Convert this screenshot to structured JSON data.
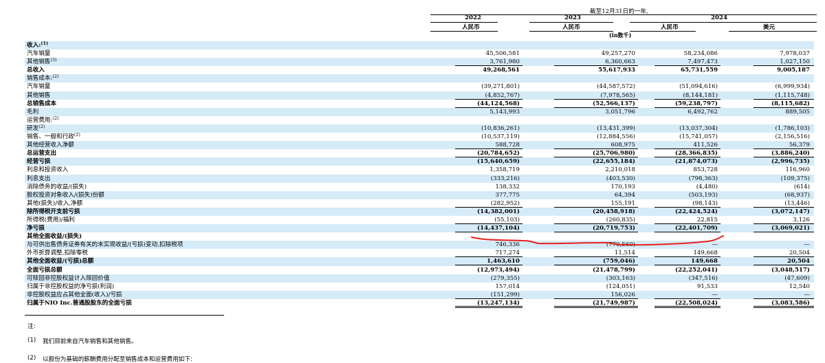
{
  "header": {
    "period": "截至12月31日的一年,",
    "years": [
      "2022",
      "2023",
      "2024"
    ],
    "currencies": [
      "人民币",
      "人民币",
      "人民币",
      "美元"
    ],
    "units": "(in数千)"
  },
  "rows": [
    {
      "label": "收入:",
      "sup": "(1)",
      "v": [
        "",
        "",
        "",
        ""
      ],
      "bold": true
    },
    {
      "label": "汽车销量",
      "sup": "",
      "v": [
        "45,506,581",
        "49,257,270",
        "58,234,086",
        "7,978,037"
      ]
    },
    {
      "label": "其他销售",
      "sup": "(3)",
      "v": [
        "3,761,980",
        "6,360,663",
        "7,497,473",
        "1,027,150"
      ],
      "ul": "single"
    },
    {
      "label": "总收入",
      "sup": "",
      "v": [
        "49,268,561",
        "55,617,933",
        "65,731,559",
        "9,005,187"
      ],
      "bold": true
    },
    {
      "label": "销售成本:",
      "sup": "(2)",
      "v": [
        "",
        "",
        "",
        ""
      ]
    },
    {
      "label": "汽车销量",
      "sup": "",
      "v": [
        "(39,271,801)",
        "(44,587,572)",
        "(51,094,616)",
        "(6,999,934)"
      ]
    },
    {
      "label": "其他销售",
      "sup": "",
      "v": [
        "(4,852,767)",
        "(7,978,565)",
        "(8,144,181)",
        "(1,115,748)"
      ],
      "ul": "single"
    },
    {
      "label": "总销售成本",
      "sup": "",
      "v": [
        "(44,124,568)",
        "(52,566,137)",
        "(59,238,797)",
        "(8,115,682)"
      ],
      "bold": true,
      "ul": "single"
    },
    {
      "label": "毛利",
      "sup": "",
      "v": [
        "5,143,993",
        "3,051,796",
        "6,492,762",
        "889,505"
      ]
    },
    {
      "label": "运营费用:",
      "sup": "(2)",
      "v": [
        "",
        "",
        "",
        ""
      ]
    },
    {
      "label": "研发",
      "sup": "(2)",
      "v": [
        "(10,836,261)",
        "(13,431,399)",
        "(13,037,304)",
        "(1,786,103)"
      ]
    },
    {
      "label": "销售、一般和行政",
      "sup": "(2)",
      "v": [
        "(10,537,119)",
        "(12,884,556)",
        "(15,741,057)",
        "(2,156,516)"
      ]
    },
    {
      "label": "其他经营收入净额",
      "sup": "",
      "v": [
        "588,728",
        "608,975",
        "411,526",
        "56,379"
      ],
      "ul": "single"
    },
    {
      "label": "总运营支出",
      "sup": "",
      "v": [
        "(20,784,652)",
        "(25,706,980)",
        "(28,366,835)",
        "(3,886,240)"
      ],
      "bold": true,
      "ul": "single"
    },
    {
      "label": "经营亏损",
      "sup": "",
      "v": [
        "(15,640,659)",
        "(22,655,184)",
        "(21,874,073)",
        "(2,996,735)"
      ],
      "bold": true
    },
    {
      "label": "利息和投资收入",
      "sup": "",
      "v": [
        "1,358,719",
        "2,210,018",
        "853,728",
        "116,960"
      ]
    },
    {
      "label": "利息支出",
      "sup": "",
      "v": [
        "(333,216)",
        "(403,530)",
        "(798,363)",
        "(109,375)"
      ]
    },
    {
      "label": "消除债务的收益/(损失)",
      "sup": "",
      "v": [
        "138,332",
        "170,193",
        "(4,480)",
        "(614)"
      ]
    },
    {
      "label": "股权投资对象收入/(损失)份额",
      "sup": "",
      "v": [
        "377,775",
        "64,394",
        "(503,193)",
        "(68,937)"
      ]
    },
    {
      "label": "其他(损失)/收入,净额",
      "sup": "",
      "v": [
        "(282,952)",
        "155,191",
        "(98,143)",
        "(13,446)"
      ],
      "ul": "single"
    },
    {
      "label": "除所得税开支前亏损",
      "sup": "",
      "v": [
        "(14,382,001)",
        "(20,458,918)",
        "(22,424,524)",
        "(3,072,147)"
      ],
      "bold": true
    },
    {
      "label": "所得税(费用)/福利",
      "sup": "",
      "v": [
        "(55,103)",
        "(260,835)",
        "22,815",
        "3,126"
      ],
      "ul": "single"
    },
    {
      "label": "净亏损",
      "sup": "",
      "v": [
        "(14,437,104)",
        "(20,719,753)",
        "(22,401,709)",
        "(3,069,021)"
      ],
      "bold": true,
      "ul": "single"
    },
    {
      "label": "其他全面收益/(损失)",
      "sup": "",
      "v": [
        "",
        "",
        "",
        ""
      ],
      "bold": true
    },
    {
      "label": "与可供出售债务证券有关的未实现收益/(亏损)变动,扣除税项",
      "sup": "",
      "v": [
        "746,336",
        "(770,560)",
        "—",
        "—"
      ]
    },
    {
      "label": "外币折算调整,扣除零税",
      "sup": "",
      "v": [
        "717,274",
        "11,514",
        "149,668",
        "20,504"
      ],
      "ul": "single"
    },
    {
      "label": "其他全面收益/(亏损)总额",
      "sup": "",
      "v": [
        "1,463,610",
        "(759,046)",
        "149,668",
        "20,504"
      ],
      "bold": true,
      "ul": "single"
    },
    {
      "label": "全面亏损总额",
      "sup": "",
      "v": [
        "(12,973,494)",
        "(21,478,799)",
        "(22,252,041)",
        "(3,048,517)"
      ],
      "bold": true
    },
    {
      "label": "可赎回非控股权益计入赎回价值",
      "sup": "",
      "v": [
        "(279,355)",
        "(303,163)",
        "(347,516)",
        "(47,609)"
      ]
    },
    {
      "label": "归属于非控股权益的净亏损(利润)",
      "sup": "",
      "v": [
        "157,014",
        "(124,051)",
        "91,533",
        "12,540"
      ]
    },
    {
      "label": "非控股权益应占其他全面(收入)/亏损",
      "sup": "",
      "v": [
        "(151,299)",
        "156,026",
        "—",
        "—"
      ],
      "ul": "single"
    },
    {
      "label": "归属于NIO Inc.普通股股东的全面亏损",
      "sup": "",
      "v": [
        "(13,247,134)",
        "(21,749,987)",
        "(22,508,024)",
        "(3,083,586)"
      ],
      "bold": true,
      "ul": "double"
    }
  ],
  "notes": {
    "heading": "注:",
    "n1_num": "(1)",
    "n1_text": "我们目前来自汽车销售和其他销售。",
    "n2_num": "(2)",
    "n2_text": "以股份为基础的薪酬费用分配至销售成本和运营费用如下:"
  },
  "colors": {
    "row_shade": "#d6ebf8",
    "annotation": "#e8201c"
  }
}
